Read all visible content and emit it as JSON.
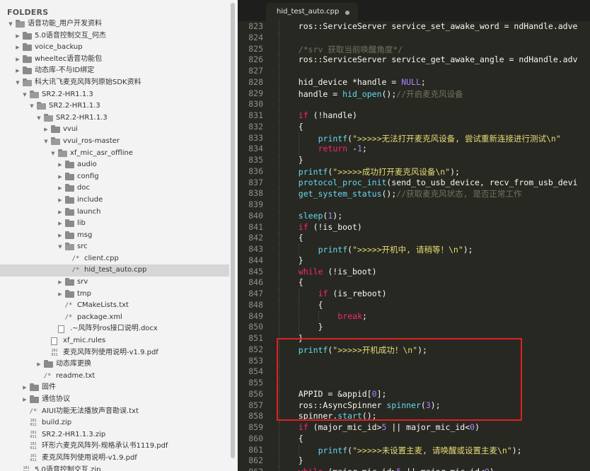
{
  "sidebar": {
    "header": "FOLDERS",
    "tree": [
      {
        "label": "语音功能_用户开发资料",
        "depth": 0,
        "kind": "folder",
        "open": true
      },
      {
        "label": "5.0语音控制交互_何杰",
        "depth": 1,
        "kind": "folder",
        "open": false
      },
      {
        "label": "voice_backup",
        "depth": 1,
        "kind": "folder",
        "open": false
      },
      {
        "label": "wheeltec语音功能包",
        "depth": 1,
        "kind": "folder",
        "open": false
      },
      {
        "label": "动态库-不与ID绑定",
        "depth": 1,
        "kind": "folder",
        "open": false
      },
      {
        "label": "科大讯飞麦克风阵列原始SDK资料",
        "depth": 1,
        "kind": "folder",
        "open": true
      },
      {
        "label": "SR2.2-HR1.1.3",
        "depth": 2,
        "kind": "folder",
        "open": true
      },
      {
        "label": "SR2.2-HR1.1.3",
        "depth": 3,
        "kind": "folder",
        "open": true
      },
      {
        "label": "SR2.2-HR1.1.3",
        "depth": 4,
        "kind": "folder",
        "open": true
      },
      {
        "label": "vvui",
        "depth": 5,
        "kind": "folder",
        "open": false
      },
      {
        "label": "vvui_ros-master",
        "depth": 5,
        "kind": "folder",
        "open": true
      },
      {
        "label": "xf_mic_asr_offline",
        "depth": 6,
        "kind": "folder",
        "open": true
      },
      {
        "label": "audio",
        "depth": 7,
        "kind": "folder",
        "open": false
      },
      {
        "label": "config",
        "depth": 7,
        "kind": "folder",
        "open": false
      },
      {
        "label": "doc",
        "depth": 7,
        "kind": "folder",
        "open": false
      },
      {
        "label": "include",
        "depth": 7,
        "kind": "folder",
        "open": false
      },
      {
        "label": "launch",
        "depth": 7,
        "kind": "folder",
        "open": false
      },
      {
        "label": "lib",
        "depth": 7,
        "kind": "folder",
        "open": false
      },
      {
        "label": "msg",
        "depth": 7,
        "kind": "folder",
        "open": false
      },
      {
        "label": "src",
        "depth": 7,
        "kind": "folder",
        "open": true
      },
      {
        "label": "client.cpp",
        "depth": 8,
        "kind": "code"
      },
      {
        "label": "hid_test_auto.cpp",
        "depth": 8,
        "kind": "code",
        "selected": true
      },
      {
        "label": "srv",
        "depth": 7,
        "kind": "folder",
        "open": false
      },
      {
        "label": "tmp",
        "depth": 7,
        "kind": "folder",
        "open": false
      },
      {
        "label": "CMakeLists.txt",
        "depth": 7,
        "kind": "code"
      },
      {
        "label": "package.xml",
        "depth": 7,
        "kind": "code"
      },
      {
        "label": ".~风阵列ros接口说明.docx",
        "depth": 6,
        "kind": "file"
      },
      {
        "label": "xf_mic.rules",
        "depth": 5,
        "kind": "file"
      },
      {
        "label": "麦克风阵列使用说明-v1.9.pdf",
        "depth": 5,
        "kind": "binary"
      },
      {
        "label": "动态库更换",
        "depth": 4,
        "kind": "folder",
        "open": false
      },
      {
        "label": "readme.txt",
        "depth": 4,
        "kind": "code"
      },
      {
        "label": "固件",
        "depth": 2,
        "kind": "folder",
        "open": false
      },
      {
        "label": "通信协议",
        "depth": 2,
        "kind": "folder",
        "open": false
      },
      {
        "label": "AIUI功能无法播放声音勘误.txt",
        "depth": 2,
        "kind": "code"
      },
      {
        "label": "build.zip",
        "depth": 2,
        "kind": "binary"
      },
      {
        "label": "SR2.2-HR1.1.3.zip",
        "depth": 2,
        "kind": "binary"
      },
      {
        "label": "环形六麦克风阵列-规格承认书1119.pdf",
        "depth": 2,
        "kind": "binary"
      },
      {
        "label": "麦克风阵列使用说明-v1.9.pdf",
        "depth": 2,
        "kind": "binary"
      },
      {
        "label": "5.0语音控制交互.zip",
        "depth": 1,
        "kind": "binary"
      }
    ]
  },
  "editor": {
    "tab_title": "hid_test_auto.cpp",
    "line_numbers": [
      "823",
      "824",
      "825",
      "826",
      "827",
      "828",
      "829",
      "830",
      "831",
      "832",
      "833",
      "834",
      "835",
      "836",
      "837",
      "838",
      "839",
      "840",
      "841",
      "842",
      "843",
      "844",
      "845",
      "846",
      "847",
      "848",
      "849",
      "850",
      "851",
      "852",
      "853",
      "854",
      "855",
      "856",
      "857",
      "858",
      "859",
      "860",
      "861",
      "862",
      "863"
    ],
    "lines": [
      {
        "indent": 1,
        "tokens": [
          [
            "ty",
            "ros::ServiceServer service_set_awake_word = ndHandle.adve"
          ]
        ]
      },
      {
        "indent": 1,
        "tokens": []
      },
      {
        "indent": 1,
        "tokens": [
          [
            "cm",
            "/*srv 获取当前唤醒角度*/"
          ]
        ]
      },
      {
        "indent": 1,
        "tokens": [
          [
            "ty",
            "ros::ServiceServer service_get_awake_angle = ndHandle.adv"
          ]
        ]
      },
      {
        "indent": 1,
        "tokens": []
      },
      {
        "indent": 1,
        "tokens": [
          [
            "ty",
            "hid_device *handle = "
          ],
          [
            "cn",
            "NULL"
          ],
          [
            "ty",
            ";"
          ]
        ]
      },
      {
        "indent": 1,
        "tokens": [
          [
            "ty",
            "handle = "
          ],
          [
            "fn",
            "hid_open"
          ],
          [
            "ty",
            "();"
          ],
          [
            "cm",
            "//开启麦克风设备"
          ]
        ]
      },
      {
        "indent": 1,
        "tokens": []
      },
      {
        "indent": 1,
        "tokens": [
          [
            "kw",
            "if"
          ],
          [
            "ty",
            " (!handle)"
          ]
        ]
      },
      {
        "indent": 1,
        "tokens": [
          [
            "ty",
            "{"
          ]
        ]
      },
      {
        "indent": 2,
        "tokens": [
          [
            "fn",
            "printf"
          ],
          [
            "ty",
            "("
          ],
          [
            "str",
            "\">>>>>无法打开麦克风设备, 尝试重新连接进行测试\\n\""
          ]
        ]
      },
      {
        "indent": 2,
        "tokens": [
          [
            "kw",
            "return"
          ],
          [
            "ty",
            " -"
          ],
          [
            "num",
            "1"
          ],
          [
            "ty",
            ";"
          ]
        ]
      },
      {
        "indent": 1,
        "tokens": [
          [
            "ty",
            "}"
          ]
        ]
      },
      {
        "indent": 1,
        "tokens": [
          [
            "fn",
            "printf"
          ],
          [
            "ty",
            "("
          ],
          [
            "str",
            "\">>>>>成功打开麦克风设备\\n\""
          ],
          [
            "ty",
            ");"
          ]
        ]
      },
      {
        "indent": 1,
        "tokens": [
          [
            "fn",
            "protocol_proc_init"
          ],
          [
            "ty",
            "(send_to_usb_device, recv_from_usb_devi"
          ]
        ]
      },
      {
        "indent": 1,
        "tokens": [
          [
            "fn",
            "get_system_status"
          ],
          [
            "ty",
            "();"
          ],
          [
            "cm",
            "//获取麦克风状态, 是否正常工作"
          ]
        ]
      },
      {
        "indent": 1,
        "tokens": []
      },
      {
        "indent": 1,
        "tokens": [
          [
            "fn",
            "sleep"
          ],
          [
            "ty",
            "("
          ],
          [
            "num",
            "1"
          ],
          [
            "ty",
            ");"
          ]
        ]
      },
      {
        "indent": 1,
        "tokens": [
          [
            "kw",
            "if"
          ],
          [
            "ty",
            " (!is_boot)"
          ]
        ]
      },
      {
        "indent": 1,
        "tokens": [
          [
            "ty",
            "{"
          ]
        ]
      },
      {
        "indent": 2,
        "tokens": [
          [
            "fn",
            "printf"
          ],
          [
            "ty",
            "("
          ],
          [
            "str",
            "\">>>>>开机中, 请稍等！\\n\""
          ],
          [
            "ty",
            ");"
          ]
        ]
      },
      {
        "indent": 1,
        "tokens": [
          [
            "ty",
            "}"
          ]
        ]
      },
      {
        "indent": 1,
        "tokens": [
          [
            "kw",
            "while"
          ],
          [
            "ty",
            " (!is_boot)"
          ]
        ]
      },
      {
        "indent": 1,
        "tokens": [
          [
            "ty",
            "{"
          ]
        ]
      },
      {
        "indent": 2,
        "tokens": [
          [
            "kw",
            "if"
          ],
          [
            "ty",
            " (is_reboot)"
          ]
        ]
      },
      {
        "indent": 2,
        "tokens": [
          [
            "ty",
            "{"
          ]
        ]
      },
      {
        "indent": 3,
        "tokens": [
          [
            "kw",
            "break"
          ],
          [
            "ty",
            ";"
          ]
        ]
      },
      {
        "indent": 2,
        "tokens": [
          [
            "ty",
            "}"
          ]
        ]
      },
      {
        "indent": 1,
        "tokens": [
          [
            "ty",
            "}"
          ]
        ]
      },
      {
        "indent": 1,
        "tokens": [
          [
            "fn",
            "printf"
          ],
          [
            "ty",
            "("
          ],
          [
            "str",
            "\">>>>>开机成功！\\n\""
          ],
          [
            "ty",
            ");"
          ]
        ]
      },
      {
        "indent": 1,
        "tokens": []
      },
      {
        "indent": 1,
        "tokens": []
      },
      {
        "indent": 1,
        "tokens": []
      },
      {
        "indent": 1,
        "tokens": [
          [
            "ty",
            "APPID = &appid["
          ],
          [
            "num",
            "0"
          ],
          [
            "ty",
            "];"
          ]
        ]
      },
      {
        "indent": 1,
        "tokens": [
          [
            "ty",
            "ros::AsyncSpinner "
          ],
          [
            "fn",
            "spinner"
          ],
          [
            "ty",
            "("
          ],
          [
            "num",
            "3"
          ],
          [
            "ty",
            ");"
          ]
        ]
      },
      {
        "indent": 1,
        "tokens": [
          [
            "ty",
            "spinner."
          ],
          [
            "fn",
            "start"
          ],
          [
            "ty",
            "();"
          ]
        ]
      },
      {
        "indent": 1,
        "tokens": [
          [
            "kw",
            "if"
          ],
          [
            "ty",
            " (major_mic_id>"
          ],
          [
            "num",
            "5"
          ],
          [
            "ty",
            " || major_mic_id<"
          ],
          [
            "num",
            "0"
          ],
          [
            "ty",
            ")"
          ]
        ]
      },
      {
        "indent": 1,
        "tokens": [
          [
            "ty",
            "{"
          ]
        ]
      },
      {
        "indent": 2,
        "tokens": [
          [
            "fn",
            "printf"
          ],
          [
            "ty",
            "("
          ],
          [
            "str",
            "\">>>>>未设置主麦, 请唤醒或设置主麦\\n\""
          ],
          [
            "ty",
            ");"
          ]
        ]
      },
      {
        "indent": 1,
        "tokens": [
          [
            "ty",
            "}"
          ]
        ]
      },
      {
        "indent": 1,
        "tokens": [
          [
            "kw",
            "while"
          ],
          [
            "ty",
            " (major_mic_id>"
          ],
          [
            "num",
            "5"
          ],
          [
            "ty",
            " || major_mic_id<"
          ],
          [
            "num",
            "0"
          ],
          [
            "ty",
            ")"
          ]
        ]
      }
    ]
  },
  "colors": {
    "editor_bg": "#272822",
    "keyword": "#f92672",
    "function": "#66d9ef",
    "string": "#e6db74",
    "number": "#ae81ff",
    "comment": "#75715e",
    "annotation_box": "#e02020"
  }
}
